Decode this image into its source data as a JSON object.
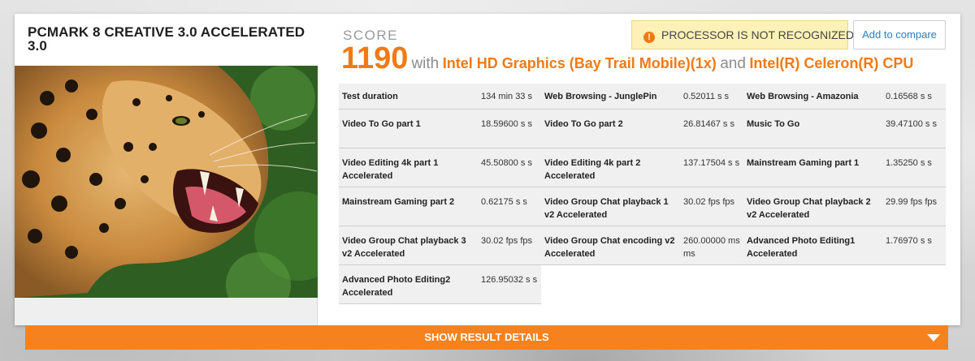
{
  "benchmark": {
    "title": "PCMARK 8 CREATIVE 3.0 ACCELERATED 3.0",
    "image_description_icon": "leopard-photo"
  },
  "score": {
    "label": "SCORE",
    "value": "1190",
    "with_text": "with",
    "gpu": "Intel HD Graphics (Bay Trail Mobile)(1x)",
    "and_text": "and",
    "cpu": "Intel(R) Celeron(R) CPU"
  },
  "warning": {
    "icon": "warning-icon",
    "text": "PROCESSOR IS NOT RECOGNIZED"
  },
  "compare_label": "Add to compare",
  "results": [
    {
      "name": "Test duration",
      "value": "134 min 33 s"
    },
    {
      "name": "Web Browsing - JunglePin",
      "value": "0.52011 s s"
    },
    {
      "name": "Web Browsing - Amazonia",
      "value": "0.16568 s s"
    },
    {
      "name": "Video To Go part 1",
      "value": "18.59600 s s"
    },
    {
      "name": "Video To Go part 2",
      "value": "26.81467 s s"
    },
    {
      "name": "Music To Go",
      "value": "39.47100 s s"
    },
    {
      "name": "Video Editing 4k part 1 Accelerated",
      "value": "45.50800 s s"
    },
    {
      "name": "Video Editing 4k part 2 Accelerated",
      "value": "137.17504 s s"
    },
    {
      "name": "Mainstream Gaming part 1",
      "value": "1.35250 s s"
    },
    {
      "name": "Mainstream Gaming part 2",
      "value": "0.62175 s s"
    },
    {
      "name": "Video Group Chat playback 1 v2 Accelerated",
      "value": "30.02 fps fps"
    },
    {
      "name": "Video Group Chat playback 2 v2 Accelerated",
      "value": "29.99 fps fps"
    },
    {
      "name": "Video Group Chat playback 3 v2 Accelerated",
      "value": "30.02 fps fps"
    },
    {
      "name": "Video Group Chat encoding v2 Accelerated",
      "value": "260.00000 ms ms"
    },
    {
      "name": "Advanced Photo Editing1 Accelerated",
      "value": "1.76970 s s"
    },
    {
      "name": "Advanced Photo Editing2 Accelerated",
      "value": "126.95032 s s"
    }
  ],
  "details_button": {
    "label": "SHOW RESULT DETAILS",
    "icon": "chevron-down-icon"
  },
  "colors": {
    "accent": "#f5821f",
    "score": "#ef7a16",
    "warning_bg": "#fcf2b8",
    "link": "#2f7db8"
  }
}
